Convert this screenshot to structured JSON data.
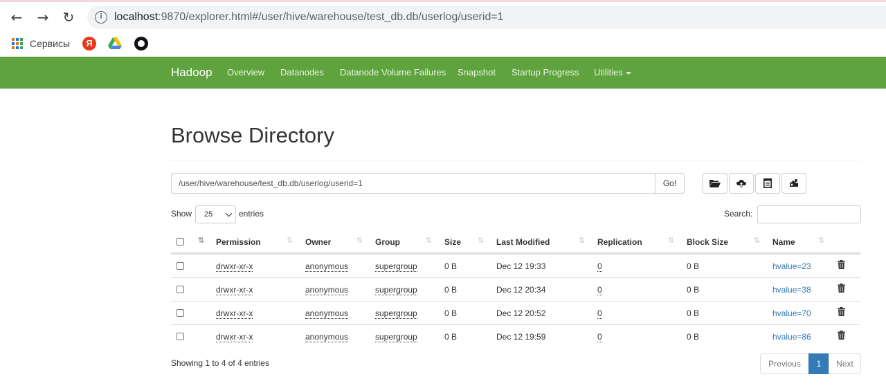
{
  "browser": {
    "url_host": "localhost",
    "url_rest": ":9870/explorer.html#/user/hive/warehouse/test_db.db/userlog/userid=1",
    "bookmarks": [
      {
        "label": "Сервисы"
      }
    ]
  },
  "navbar": {
    "brand": "Hadoop",
    "links": [
      "Overview",
      "Datanodes",
      "Datanode Volume Failures",
      "Snapshot",
      "Startup Progress",
      "Utilities"
    ]
  },
  "page": {
    "title": "Browse Directory",
    "path_value": "/user/hive/warehouse/test_db.db/userlog/userid=1",
    "go_label": "Go!"
  },
  "table_controls": {
    "show_label": "Show",
    "entries_value": "25",
    "entries_label": "entries",
    "search_label": "Search:"
  },
  "table": {
    "columns": [
      "Permission",
      "Owner",
      "Group",
      "Size",
      "Last Modified",
      "Replication",
      "Block Size",
      "Name"
    ],
    "rows": [
      {
        "permission": "drwxr-xr-x",
        "owner": "anonymous",
        "group": "supergroup",
        "size": "0 B",
        "modified": "Dec 12 19:33",
        "replication": "0",
        "block_size": "0 B",
        "name": "hvalue=23"
      },
      {
        "permission": "drwxr-xr-x",
        "owner": "anonymous",
        "group": "supergroup",
        "size": "0 B",
        "modified": "Dec 12 20:34",
        "replication": "0",
        "block_size": "0 B",
        "name": "hvalue=38"
      },
      {
        "permission": "drwxr-xr-x",
        "owner": "anonymous",
        "group": "supergroup",
        "size": "0 B",
        "modified": "Dec 12 20:52",
        "replication": "0",
        "block_size": "0 B",
        "name": "hvalue=70"
      },
      {
        "permission": "drwxr-xr-x",
        "owner": "anonymous",
        "group": "supergroup",
        "size": "0 B",
        "modified": "Dec 12 19:59",
        "replication": "0",
        "block_size": "0 B",
        "name": "hvalue=86"
      }
    ]
  },
  "footer": {
    "info": "Showing 1 to 4 of 4 entries",
    "previous": "Previous",
    "current_page": "1",
    "next": "Next"
  },
  "colors": {
    "navbar": "#5fa33e",
    "link": "#337ab7",
    "active_page": "#337ab7"
  }
}
